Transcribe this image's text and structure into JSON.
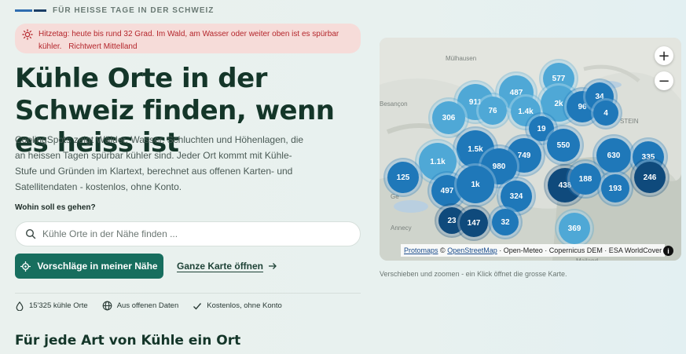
{
  "eyebrow": "FÜR HEISSE TAGE IN DER SCHWEIZ",
  "alert": {
    "text": "Hitzetag: heute bis rund 32 Grad. Im Wald, am Wasser oder weiter oben ist es spürbar kühler.",
    "note": "Richtwert Mittelland"
  },
  "hero": {
    "title": "Kühle Orte in der Schweiz finden, wenn es heiss ist",
    "lead": "CoolingSpots zeigt Wälder, Wasser, Schluchten und Höhenlagen, die an heissen Tagen spürbar kühler sind. Jeder Ort kommt mit Kühle-Stufe und Gründen im Klartext, berechnet aus offenen Karten- und Satellitendaten - kostenlos, ohne Konto."
  },
  "search": {
    "label": "Wohin soll es gehen?",
    "placeholder": "Kühle Orte in der Nähe finden ..."
  },
  "actions": {
    "primary": "Vorschläge in meiner Nähe",
    "secondary": "Ganze Karte öffnen"
  },
  "features": [
    {
      "icon": "droplet-icon",
      "label": "15'325 kühle Orte"
    },
    {
      "icon": "globe-icon",
      "label": "Aus offenen Daten"
    },
    {
      "icon": "check-icon",
      "label": "Kostenlos, ohne Konto"
    }
  ],
  "section_title": "Für jede Art von Kühle ein Ort",
  "map": {
    "zoom_in": "+",
    "zoom_out": "−",
    "caption": "Verschieben und zoomen - ein Klick öffnet die grosse Karte.",
    "attribution": {
      "protomaps": "Protomaps",
      "copy": "©",
      "osm": "OpenStreetMap",
      "rest": "· Open-Meteo · Copernicus DEM · ESA WorldCover"
    },
    "places": [
      {
        "label": "Mülhausen"
      },
      {
        "label": "Besançon"
      },
      {
        "label": "STEIN"
      },
      {
        "label": "Ge"
      },
      {
        "label": "Annecy"
      },
      {
        "label": "Mailand"
      }
    ],
    "clusters": [
      {
        "label": "577",
        "shade": "light"
      },
      {
        "label": "487",
        "shade": "light"
      },
      {
        "label": "911",
        "shade": "light"
      },
      {
        "label": "76",
        "shade": "light"
      },
      {
        "label": "2k",
        "shade": "light"
      },
      {
        "label": "1.4k",
        "shade": "light"
      },
      {
        "label": "96",
        "shade": "mid"
      },
      {
        "label": "34",
        "shade": "mid"
      },
      {
        "label": "4",
        "shade": "mid"
      },
      {
        "label": "306",
        "shade": "light"
      },
      {
        "label": "19",
        "shade": "mid"
      },
      {
        "label": "550",
        "shade": "mid"
      },
      {
        "label": "1.5k",
        "shade": "mid"
      },
      {
        "label": "1.1k",
        "shade": "light"
      },
      {
        "label": "749",
        "shade": "mid"
      },
      {
        "label": "980",
        "shade": "mid"
      },
      {
        "label": "630",
        "shade": "mid"
      },
      {
        "label": "335",
        "shade": "mid"
      },
      {
        "label": "125",
        "shade": "mid"
      },
      {
        "label": "497",
        "shade": "mid"
      },
      {
        "label": "1k",
        "shade": "mid"
      },
      {
        "label": "438",
        "shade": "dark"
      },
      {
        "label": "188",
        "shade": "mid"
      },
      {
        "label": "193",
        "shade": "mid"
      },
      {
        "label": "246",
        "shade": "dark"
      },
      {
        "label": "324",
        "shade": "mid"
      },
      {
        "label": "23",
        "shade": "dark"
      },
      {
        "label": "147",
        "shade": "dark"
      },
      {
        "label": "32",
        "shade": "mid"
      },
      {
        "label": "369",
        "shade": "light"
      }
    ]
  },
  "colors": {
    "accent": "#176e5e",
    "alert_bg": "#f6dcd9",
    "alert_text": "#b4262c",
    "title": "#143629"
  }
}
